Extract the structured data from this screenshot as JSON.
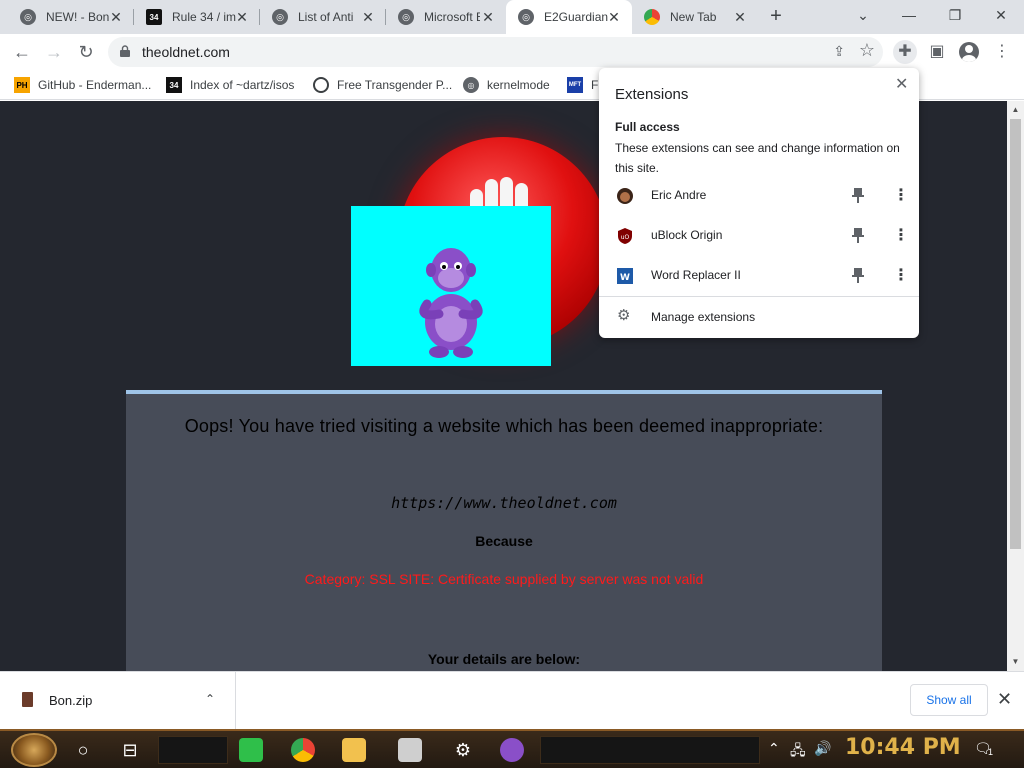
{
  "browser": {
    "tabs": [
      {
        "title": "NEW! - Bon",
        "favicon": "globe-icon",
        "active": false
      },
      {
        "title": "Rule 34 / im",
        "favicon": "r34-icon",
        "active": false
      },
      {
        "title": "List of Anti",
        "favicon": "globe-icon",
        "active": false
      },
      {
        "title": "Microsoft E",
        "favicon": "globe-icon",
        "active": false
      },
      {
        "title": "E2Guardian",
        "favicon": "globe-icon",
        "active": true
      },
      {
        "title": "New Tab",
        "favicon": "chrome-icon",
        "active": false
      }
    ],
    "new_tab_symbol": "+",
    "url": "theoldnet.com",
    "bookmarks": [
      {
        "label": "GitHub - Enderman...",
        "icon": "ph-icon"
      },
      {
        "label": "Index of ~dartz/isos",
        "icon": "r34-icon"
      },
      {
        "label": "Free Transgender P...",
        "icon": "steam-icon"
      },
      {
        "label": "kernelmode",
        "icon": "globe-icon"
      },
      {
        "label": "Fi",
        "icon": "mft-icon"
      }
    ]
  },
  "extensions_popup": {
    "title": "Extensions",
    "section": "Full access",
    "description": "These extensions can see and change information on this site.",
    "items": [
      {
        "name": "Eric Andre",
        "icon": "eric-andre-icon"
      },
      {
        "name": "uBlock Origin",
        "icon": "ublock-icon"
      },
      {
        "name": "Word Replacer II",
        "icon": "word-replacer-icon"
      }
    ],
    "manage_label": "Manage extensions"
  },
  "page": {
    "heading": "Oops! You have tried visiting a website which has been deemed inappropriate:",
    "blocked_url": "https://www.theoldnet.com",
    "because": "Because",
    "reason": "Category: SSL SITE:  Certificate supplied by server was not valid",
    "details": "Your details are below:"
  },
  "downloads": {
    "file_name": "Bon.zip",
    "show_all": "Show all"
  },
  "taskbar": {
    "clock": "10:44 PM",
    "notification_count": "1"
  },
  "colors": {
    "page_bg": "#24272f",
    "card_bg": "#474c58",
    "reason_red": "#ff1a1a",
    "bonzi_bg": "#00ffff"
  }
}
